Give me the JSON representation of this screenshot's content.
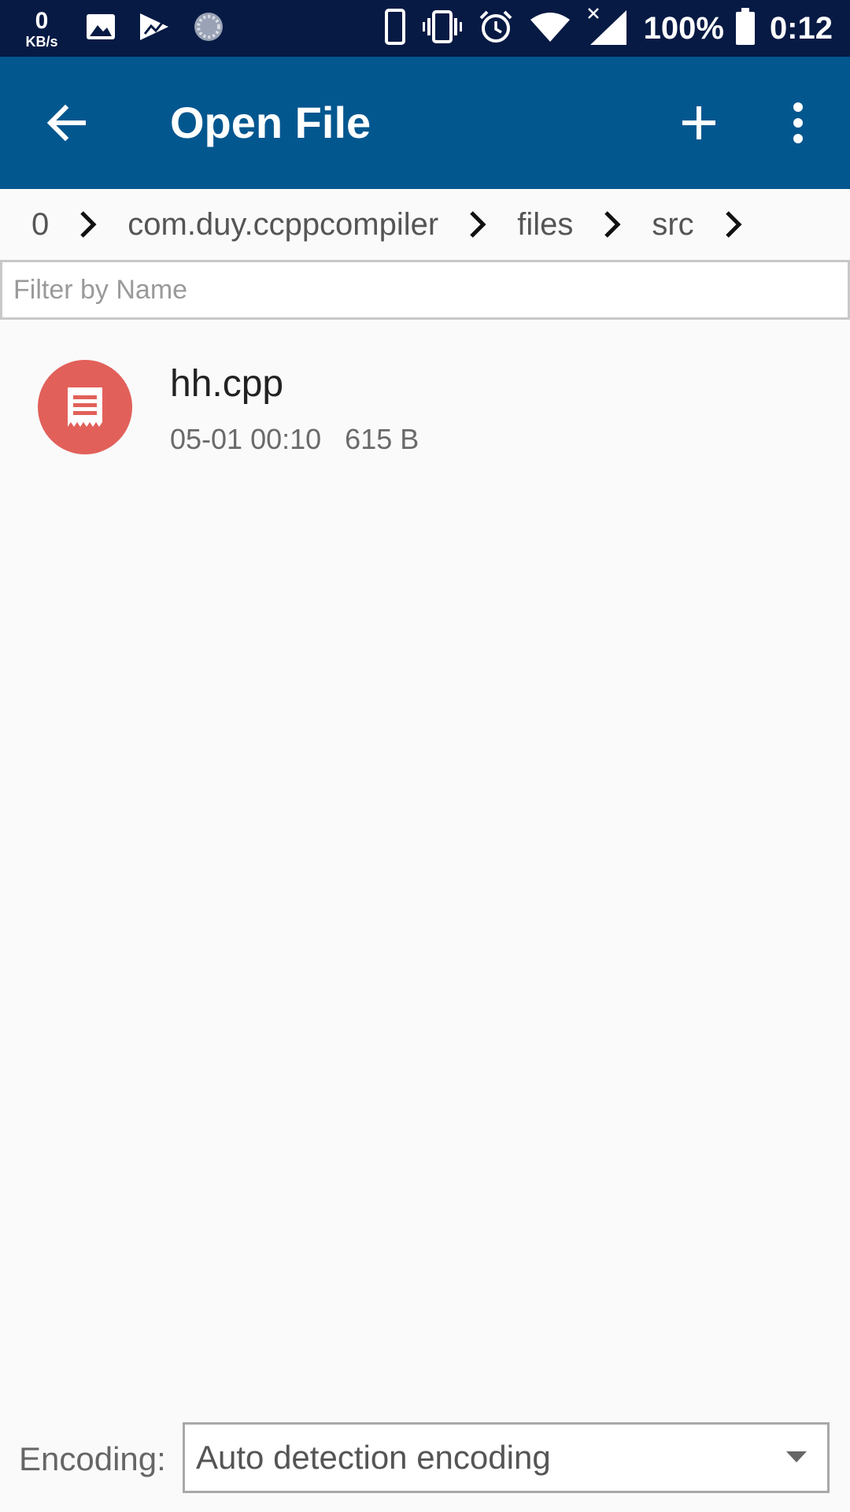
{
  "status_bar": {
    "net_speed_value": "0",
    "net_speed_unit": "KB/s",
    "battery_percent": "100%",
    "time": "0:12",
    "icons_left": [
      "gallery-icon",
      "play-store-icon",
      "loading-icon"
    ],
    "icons_right": [
      "phone-icon",
      "vibrate-icon",
      "alarm-icon",
      "wifi-icon",
      "signal-icon",
      "battery-icon"
    ]
  },
  "app_bar": {
    "title": "Open File",
    "back_icon": "arrow-back-icon",
    "add_icon": "add-icon",
    "more_icon": "more-vert-icon"
  },
  "breadcrumb": {
    "items": [
      "0",
      "com.duy.ccppcompiler",
      "files",
      "src"
    ]
  },
  "filter": {
    "placeholder": "Filter by Name",
    "value": ""
  },
  "files": [
    {
      "name": "hh.cpp",
      "date": "05-01 00:10",
      "size": "615 B",
      "meta": "05-01 00:10   615 B",
      "icon": "document-icon",
      "icon_color": "#e2605a"
    }
  ],
  "encoding": {
    "label": "Encoding:",
    "selected": "Auto detection encoding"
  },
  "colors": {
    "status_bar": "#061a44",
    "app_bar": "#03578f",
    "background": "#fafafa",
    "file_icon": "#e2605a"
  }
}
